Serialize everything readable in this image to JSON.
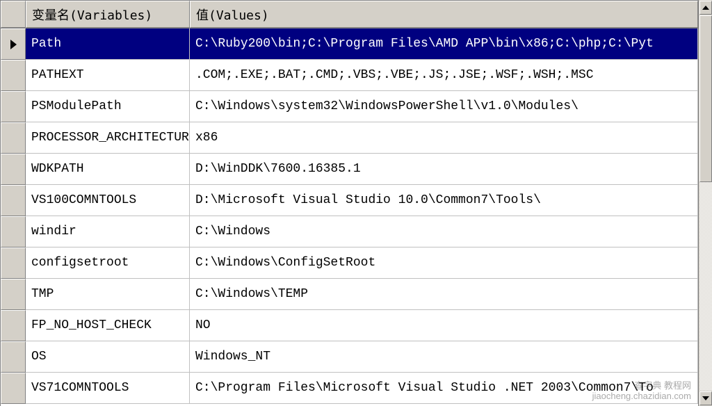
{
  "headers": {
    "variables": "变量名(Variables)",
    "values": "值(Values)"
  },
  "rows": [
    {
      "variable": "Path",
      "value": "C:\\Ruby200\\bin;C:\\Program Files\\AMD APP\\bin\\x86;C:\\php;C:\\Pyt",
      "selected": true
    },
    {
      "variable": "PATHEXT",
      "value": ".COM;.EXE;.BAT;.CMD;.VBS;.VBE;.JS;.JSE;.WSF;.WSH;.MSC",
      "selected": false
    },
    {
      "variable": "PSModulePath",
      "value": "C:\\Windows\\system32\\WindowsPowerShell\\v1.0\\Modules\\",
      "selected": false
    },
    {
      "variable": "PROCESSOR_ARCHITECTURE",
      "value": "x86",
      "selected": false
    },
    {
      "variable": "WDKPATH",
      "value": "D:\\WinDDK\\7600.16385.1",
      "selected": false
    },
    {
      "variable": "VS100COMNTOOLS",
      "value": "D:\\Microsoft Visual Studio 10.0\\Common7\\Tools\\",
      "selected": false
    },
    {
      "variable": "windir",
      "value": "C:\\Windows",
      "selected": false
    },
    {
      "variable": "configsetroot",
      "value": "C:\\Windows\\ConfigSetRoot",
      "selected": false
    },
    {
      "variable": "TMP",
      "value": "C:\\Windows\\TEMP",
      "selected": false
    },
    {
      "variable": "FP_NO_HOST_CHECK",
      "value": "NO",
      "selected": false
    },
    {
      "variable": "OS",
      "value": "Windows_NT",
      "selected": false
    },
    {
      "variable": "VS71COMNTOOLS",
      "value": "C:\\Program Files\\Microsoft Visual Studio .NET 2003\\Common7\\To",
      "selected": false
    }
  ],
  "watermark": {
    "line1": "查字典 教程网",
    "line2": "jiaocheng.chazidian.com"
  }
}
